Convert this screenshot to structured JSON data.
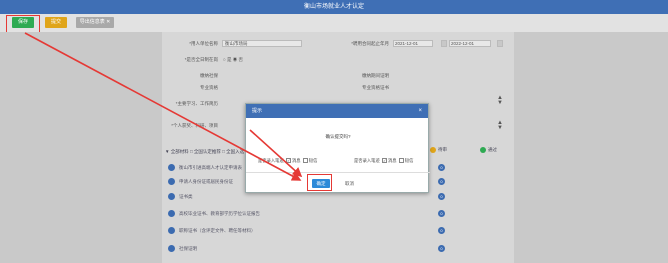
{
  "window": {
    "title": "衡山市场就业人才认定"
  },
  "toolbar": {
    "save_label": "保存",
    "submit_label": "提交",
    "import_label": "导出信息表 ✕"
  },
  "form": {
    "row0_value": "",
    "employer_label": "*用人单位名称",
    "employer_value": "衡山市场局",
    "contract_label": "*聘用合同起止年月",
    "contract_from": "2021-12-01",
    "contract_to": "2022-12-01",
    "full_time_label": "*是否全日制在岗",
    "full_time_yes": "是",
    "full_time_no": "否",
    "social_ins_label": "缴纳社保",
    "social_ins_label2": "缴纳期间证明",
    "pro_title_label": "专业资格",
    "pro_title_label2": "专业资格证书",
    "study_label": "*主要学习、工作简历",
    "award_label": "*个人获奖、科研、项目"
  },
  "categories": {
    "header": "▼ 全部材料  □ 全国认定推荐  □ 全国入选",
    "legend": [
      {
        "label": "待上传",
        "color": "#8e44ad"
      },
      {
        "label": "待审",
        "color": "#e0a51a"
      },
      {
        "label": "通过",
        "color": "#2eaa52"
      }
    ]
  },
  "list": [
    {
      "text": "衡山市引进高端人才认定申请表",
      "num": "0"
    },
    {
      "text": "申请人身份证或居民身份证",
      "num": "0"
    },
    {
      "text": "证书类",
      "num": "0"
    },
    {
      "text": "高校毕业证书、教育部学历学位认证报告",
      "num": "0"
    },
    {
      "text": "职称证书（含评定文件、聘任等材料）",
      "num": "0"
    },
    {
      "text": "社保证明",
      "num": "0"
    }
  ],
  "dialog": {
    "title": "提示",
    "close": "×",
    "message": "确认提交吗?",
    "left_opt_label": "是否录入笔迹",
    "left_check1": "✓",
    "left_check1_label": "消息",
    "left_check2_label": "短信",
    "right_opt_label": "是否录入笔迹",
    "right_check1": "✓",
    "right_check1_label": "消息",
    "right_check2_label": "短信",
    "ok_label": "确定",
    "cancel_label": "取消"
  },
  "colors": {
    "header": "#3f6fb5",
    "save": "#2eaa52",
    "submit": "#e0a51a",
    "highlight": "#e53935"
  }
}
